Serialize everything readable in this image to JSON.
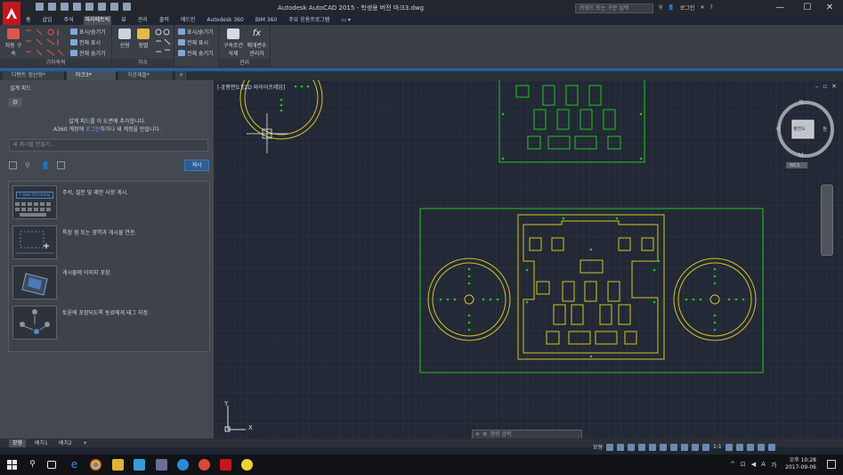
{
  "window": {
    "title": "Autodesk AutoCAD 2015 - 학생용 버전    마크3.dwg",
    "search_placeholder": "키워드 또는 구문 입력",
    "login_label": "로그인",
    "controls": {
      "minimize": "—",
      "maximize": "☐",
      "close": "✕"
    }
  },
  "menu_tabs": [
    "홈",
    "삽입",
    "주석",
    "파라메트릭",
    "뷰",
    "관리",
    "출력",
    "애드인",
    "Autodesk 360",
    "BIM 360",
    "주요 응용프로그램",
    "▭ ▾"
  ],
  "active_menu_tab": "파라메트릭",
  "ribbon": {
    "geometric": {
      "title": "기하학적",
      "big_label": "자동 구속",
      "items": [
        "표시/숨기기",
        "전체 표시",
        "전체 숨기기"
      ]
    },
    "dimensional": {
      "title": "치수",
      "items": [
        "선형",
        "정렬"
      ],
      "list": [
        "표시/숨기기",
        "전체 표시",
        "전체 숨기기"
      ]
    },
    "manage": {
      "title": "관리",
      "items": [
        "구속조건 삭제",
        "매개변수 관리자"
      ]
    }
  },
  "doc_tabs": [
    {
      "label": "디펜트 정산형*",
      "active": false
    },
    {
      "label": "마크3*",
      "active": true
    },
    {
      "label": "가공재물*",
      "active": false
    },
    {
      "label": "+",
      "active": false
    }
  ],
  "palette": {
    "title": "설계 피드",
    "message_line1": "설계 피드를 이 도면에 추가합니다.",
    "message_line2_pre": "A360 계정에 ",
    "message_line2_link": "로그인",
    "message_line2_post": "하거나 새 계정을 만듭니다.",
    "input_placeholder": "새 게시물 만들기...",
    "post_button": "게시",
    "tips": [
      {
        "text": "주석, 질문 및 제안 사항 게시.",
        "thumb": "I was thinking"
      },
      {
        "text": "특정 점 또는 영역과 게시물 연관."
      },
      {
        "text": "게시물에 이미지 포함."
      },
      {
        "text": "토론에 포함되도록 동료에게 태그 지정."
      }
    ]
  },
  "canvas": {
    "viewport_label": "[-][평면도][2D 와이어프레임]",
    "viewcube": {
      "north": "북",
      "south": "남",
      "east": "동",
      "west": "서",
      "face": "평면도",
      "wcs": "WCS"
    },
    "ucs": {
      "x": "X",
      "y": "Y"
    }
  },
  "command_line": {
    "placeholder": "명령 입력",
    "close": "✕",
    "wrench": "🔧"
  },
  "layout_tabs": [
    {
      "label": "모형",
      "active": true
    },
    {
      "label": "배치1",
      "active": false
    },
    {
      "label": "배치2",
      "active": false
    },
    {
      "label": "+",
      "active": false
    }
  ],
  "status": {
    "model": "모형",
    "scale": "1:1"
  },
  "taskbar": {
    "time": "오후 10:28",
    "date": "2017-09-06",
    "lang": "A",
    "lang2": "가"
  },
  "colors": {
    "drawing_green": "#21c321",
    "drawing_yellow": "#d2c326",
    "canvas_bg": "#222834",
    "accent": "#2d5d94",
    "autocad_red": "#c4161c"
  }
}
